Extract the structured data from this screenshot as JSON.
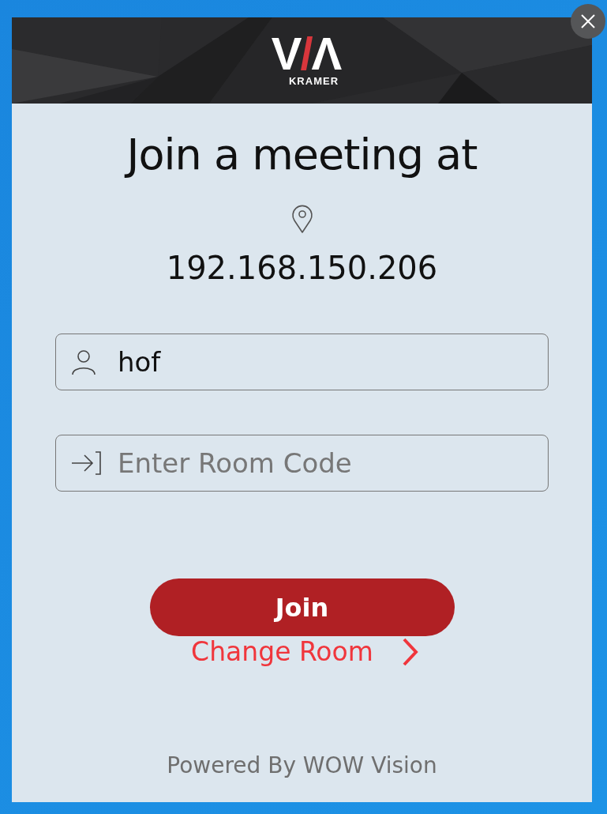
{
  "logo": {
    "parts": [
      "V",
      "/",
      "Λ"
    ],
    "wordmark": "KRAMER"
  },
  "title": "Join a meeting at",
  "address": "192.168.150.206",
  "fields": [
    {
      "kind": "name",
      "value": "hof"
    },
    {
      "kind": "code",
      "placeholder": "Enter Room Code"
    }
  ],
  "join_button": "Join",
  "change_room_link": "Change Room",
  "footer": "Powered By WOW Vision"
}
